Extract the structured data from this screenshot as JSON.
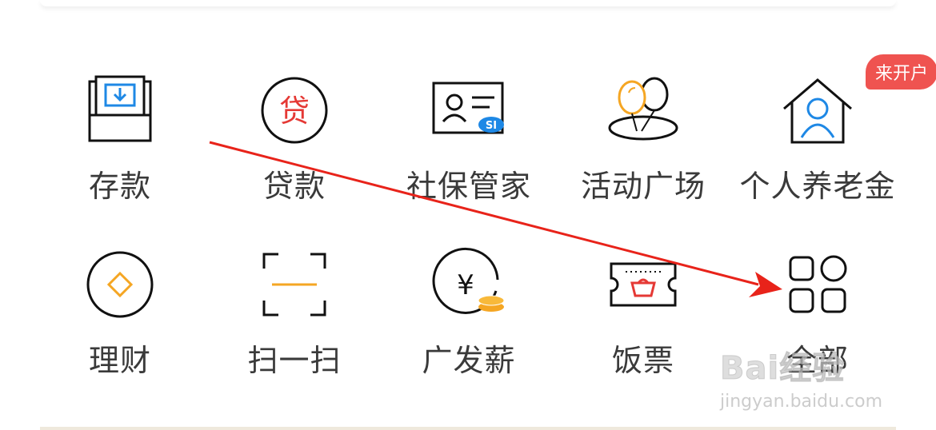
{
  "menu": {
    "items": [
      {
        "label": "存款",
        "icon": "deposit-icon"
      },
      {
        "label": "贷款",
        "icon": "loan-icon",
        "icon_text": "贷"
      },
      {
        "label": "社保管家",
        "icon": "social-security-icon",
        "icon_text": "SI"
      },
      {
        "label": "活动广场",
        "icon": "balloons-icon"
      },
      {
        "label": "个人养老金",
        "icon": "pension-house-icon",
        "badge": "来开户"
      },
      {
        "label": "理财",
        "icon": "wealth-diamond-icon"
      },
      {
        "label": "扫一扫",
        "icon": "scan-icon"
      },
      {
        "label": "广发薪",
        "icon": "salary-yen-icon",
        "icon_text": "¥"
      },
      {
        "label": "饭票",
        "icon": "meal-ticket-icon"
      },
      {
        "label": "全部",
        "icon": "all-grid-icon"
      }
    ]
  },
  "watermark": {
    "logo": "Bai经验",
    "sub": "jingyan.baidu.com"
  },
  "colors": {
    "accent_orange": "#f5a623",
    "accent_red": "#e53935",
    "accent_blue": "#1e88e5",
    "badge_red": "#ef5350",
    "text": "#3a3a3a",
    "annotation_arrow": "#e8231a"
  }
}
